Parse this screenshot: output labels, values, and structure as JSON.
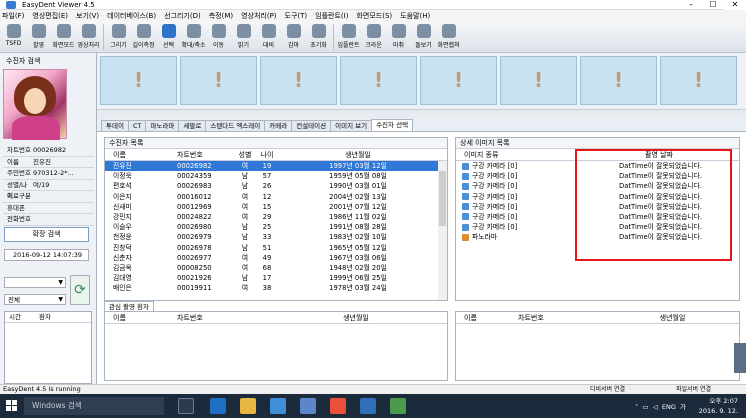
{
  "window": {
    "title": "EasyDent Viewer 4.5"
  },
  "menu": [
    "파일(F)",
    "영상편집(E)",
    "보기(V)",
    "데이터베이스(B)",
    "선그리기(D)",
    "측정(M)",
    "영상처리(P)",
    "도구(T)",
    "임플란트(I)",
    "화면모드(S)",
    "도움말(H)"
  ],
  "toolbar": [
    "TSFD",
    "촬영",
    "화면모드",
    "영상처리",
    "그리기",
    "길이측정",
    "선택",
    "확대/축소",
    "이동",
    "밝기",
    "대비",
    "감마",
    "초기화",
    "임플란트",
    "크라운",
    "마취",
    "돌보기",
    "화면캡쳐"
  ],
  "left": {
    "title": "수진자 검색",
    "info": [
      {
        "k": "차트번호",
        "v": "00026982"
      },
      {
        "k": "이름",
        "v": "진유진"
      },
      {
        "k": "주민번호",
        "v": "970312-2*..."
      },
      {
        "k": "성별/나이",
        "v": "여/19"
      },
      {
        "k": "치료구분",
        "v": ""
      },
      {
        "k": "휴대폰",
        "v": ""
      },
      {
        "k": "전화번호",
        "v": ""
      }
    ],
    "search_button": "확장 검색",
    "datetime": "2016-09-12 14:07:39",
    "combo2": "전체",
    "small_table": {
      "col1": "시간",
      "col2": "환자"
    }
  },
  "thumb_mark": "!",
  "tabs": [
    "투데이",
    "CT",
    "파노라마",
    "세팔로",
    "스탠다드 엑스레이",
    "카메라",
    "컨설테이션",
    "이미지 보기",
    "수진자 선택"
  ],
  "patients": {
    "title": "수진자 목록",
    "columns": [
      "이름",
      "차트번호",
      "성별",
      "나이",
      "생년월일"
    ],
    "rows": [
      {
        "name": "진유진",
        "chart": "00026982",
        "sex": "여",
        "age": "19",
        "birth": "1997년 03월 12일"
      },
      {
        "name": "이정욱",
        "chart": "00024359",
        "sex": "남",
        "age": "57",
        "birth": "1959년 05월 08일"
      },
      {
        "name": "편호석",
        "chart": "00026983",
        "sex": "남",
        "age": "26",
        "birth": "1990년 03월 01일"
      },
      {
        "name": "이은지",
        "chart": "00016012",
        "sex": "여",
        "age": "12",
        "birth": "2004년 02월 13일"
      },
      {
        "name": "신새미",
        "chart": "00012969",
        "sex": "여",
        "age": "15",
        "birth": "2001년 07월 12일"
      },
      {
        "name": "강민지",
        "chart": "00024822",
        "sex": "여",
        "age": "29",
        "birth": "1986년 11월 02일"
      },
      {
        "name": "이슬우",
        "chart": "00026980",
        "sex": "남",
        "age": "25",
        "birth": "1991년 08월 28일"
      },
      {
        "name": "천정윤",
        "chart": "00026979",
        "sex": "남",
        "age": "33",
        "birth": "1983년 02월 10일"
      },
      {
        "name": "진창덕",
        "chart": "00026978",
        "sex": "남",
        "age": "51",
        "birth": "1965년 05월 12일"
      },
      {
        "name": "신춘자",
        "chart": "00026977",
        "sex": "여",
        "age": "49",
        "birth": "1967년 03월 06일"
      },
      {
        "name": "김금옥",
        "chart": "00008250",
        "sex": "여",
        "age": "68",
        "birth": "1948년 02월 20일"
      },
      {
        "name": "김대영",
        "chart": "00021926",
        "sex": "남",
        "age": "17",
        "birth": "1999년 06월 25일"
      },
      {
        "name": "배인은",
        "chart": "00019911",
        "sex": "여",
        "age": "38",
        "birth": "1978년 03월 24일"
      }
    ]
  },
  "images": {
    "title": "상세 이미지 목록",
    "columns": [
      "이미지 종류",
      "촬영 날짜"
    ],
    "rows": [
      {
        "type": "구강 카메라 [0]",
        "date": "DatTime이 잘못되었습니다.",
        "pano": false
      },
      {
        "type": "구강 카메라 [0]",
        "date": "DatTime이 잘못되었습니다.",
        "pano": false
      },
      {
        "type": "구강 카메라 [0]",
        "date": "DatTime이 잘못되었습니다.",
        "pano": false
      },
      {
        "type": "구강 카메라 [0]",
        "date": "DatTime이 잘못되었습니다.",
        "pano": false
      },
      {
        "type": "구강 카메라 [0]",
        "date": "DatTime이 잘못되었습니다.",
        "pano": false
      },
      {
        "type": "구강 카메라 [0]",
        "date": "DatTime이 잘못되었습니다.",
        "pano": false
      },
      {
        "type": "구강 카메라 [0]",
        "date": "DatTime이 잘못되었습니다.",
        "pano": false
      },
      {
        "type": "파노라마",
        "date": "DatTime이 잘못되었습니다.",
        "pano": true
      }
    ]
  },
  "related": {
    "tab": "관심 촬영 환자",
    "columns": [
      "이름",
      "차트번호",
      "생년월일"
    ]
  },
  "bottom_right": {
    "columns": [
      "이름",
      "차트번호",
      "생년월일"
    ]
  },
  "status": {
    "text": "EasyDent 4.5 is running",
    "seg1": "디비서버 연결",
    "seg2": "파일서버 연결"
  },
  "taskbar": {
    "search": "Windows 검색",
    "lang": "ENG",
    "lang2": "가",
    "time": "오후 2:07",
    "date": "2016. 9. 12."
  },
  "colors": {
    "selection": "#3178d6",
    "highlight_box": "#e5161b"
  }
}
